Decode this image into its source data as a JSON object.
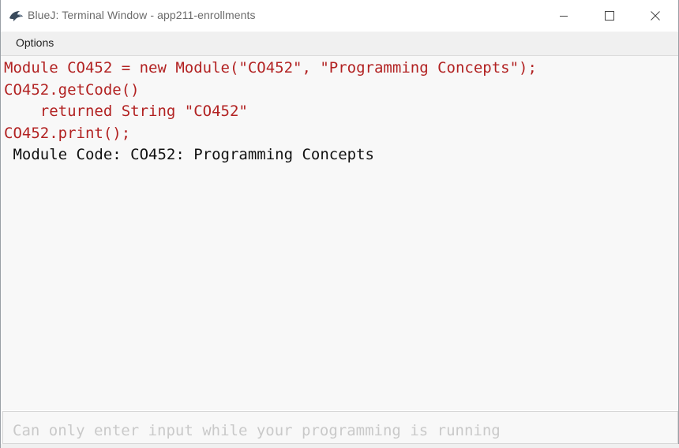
{
  "window": {
    "title": "BlueJ: Terminal Window - app211-enrollments",
    "icon": "bluej-bird-icon"
  },
  "titlebar_controls": {
    "minimize": "minimize-icon",
    "maximize": "maximize-icon",
    "close": "close-icon"
  },
  "menu": {
    "items": [
      {
        "label": "Options"
      }
    ]
  },
  "terminal": {
    "lines": [
      {
        "kind": "code",
        "text": "Module CO452 = new Module(\"CO452\", \"Programming Concepts\");"
      },
      {
        "kind": "code",
        "text": "CO452.getCode()"
      },
      {
        "kind": "code",
        "text": "    returned String \"CO452\""
      },
      {
        "kind": "code",
        "text": "CO452.print();"
      },
      {
        "kind": "output",
        "text": " Module Code: CO452: Programming Concepts"
      }
    ]
  },
  "input": {
    "placeholder": "Can only enter input while your programming is running",
    "value": ""
  },
  "colors": {
    "code_text": "#b22222",
    "output_text": "#111111",
    "terminal_bg": "#f8f8f8",
    "menubar_bg": "#f0f0f0"
  }
}
